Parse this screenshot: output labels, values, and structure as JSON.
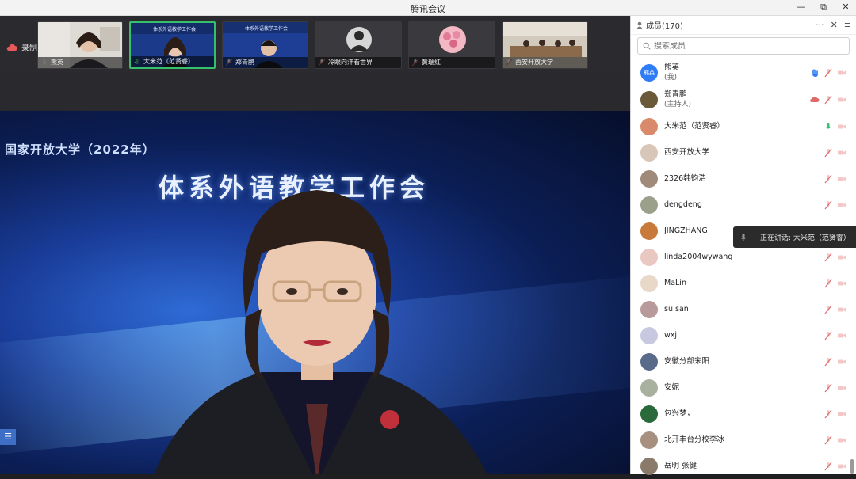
{
  "window": {
    "title": "腾讯会议",
    "min": "—",
    "restore": "⧉",
    "close": "✕"
  },
  "recording": {
    "label": "录制中"
  },
  "thumbnails": [
    {
      "name": "熊英",
      "active": false,
      "bg": "#d9d4cf"
    },
    {
      "name": "大米范（范贤睿）",
      "active": true,
      "bg": "#1b3a8a"
    },
    {
      "name": "郑青鹏",
      "active": false,
      "bg": "#1d3e94"
    },
    {
      "name": "冷眼向洋看世界",
      "active": false,
      "bg": "#3a3a3e"
    },
    {
      "name": "黄瑞红",
      "active": false,
      "bg": "#3a3a3e"
    },
    {
      "name": "西安开放大学",
      "active": false,
      "bg": "#cfc8bd"
    }
  ],
  "main_video": {
    "heading_small": "国家开放大学（2022年）",
    "heading_large": "体系外语教学工作会"
  },
  "side_button": "☰",
  "panel": {
    "title": "成员(170)",
    "more": "···",
    "close": "✕",
    "menu": "≡",
    "search_placeholder": "搜索成员"
  },
  "members": [
    {
      "name": "熊英",
      "sub": "(我)",
      "avatar_text": "熊英",
      "avatar_color": "#2f7df6",
      "mic": "hand"
    },
    {
      "name": "郑青鹏",
      "sub": "(主持人)",
      "avatar_text": "",
      "avatar_color": "#6b5a3a",
      "mic": "muted"
    },
    {
      "name": "大米范（范贤睿）",
      "sub": "",
      "avatar_text": "",
      "avatar_color": "#d98a6a",
      "mic": "on"
    },
    {
      "name": "西安开放大学",
      "sub": "",
      "avatar_text": "",
      "avatar_color": "#d8c6b8",
      "mic": "muted"
    },
    {
      "name": "2326韩钧浩",
      "sub": "",
      "avatar_text": "",
      "avatar_color": "#a08a7a",
      "mic": "muted"
    },
    {
      "name": "dengdeng",
      "sub": "",
      "avatar_text": "",
      "avatar_color": "#9aa08a",
      "mic": "muted"
    },
    {
      "name": "JINGZHANG",
      "sub": "",
      "avatar_text": "",
      "avatar_color": "#c87a3a",
      "mic": "muted"
    },
    {
      "name": "linda2004wywang",
      "sub": "",
      "avatar_text": "",
      "avatar_color": "#e8c8c0",
      "mic": "muted"
    },
    {
      "name": "MaLin",
      "sub": "",
      "avatar_text": "",
      "avatar_color": "#e8d8c8",
      "mic": "muted"
    },
    {
      "name": "su san",
      "sub": "",
      "avatar_text": "",
      "avatar_color": "#b89a9a",
      "mic": "muted"
    },
    {
      "name": "wxj",
      "sub": "",
      "avatar_text": "",
      "avatar_color": "#c8c8e0",
      "mic": "muted"
    },
    {
      "name": "安徽分部宋阳",
      "sub": "",
      "avatar_text": "",
      "avatar_color": "#5a6a8a",
      "mic": "muted"
    },
    {
      "name": "安妮",
      "sub": "",
      "avatar_text": "",
      "avatar_color": "#a8b0a0",
      "mic": "muted"
    },
    {
      "name": "包兴梦，",
      "sub": "",
      "avatar_text": "",
      "avatar_color": "#2a6a3a",
      "mic": "muted"
    },
    {
      "name": "北开丰台分校李冰",
      "sub": "",
      "avatar_text": "",
      "avatar_color": "#a89080",
      "mic": "muted"
    },
    {
      "name": "岳明 张健",
      "sub": "",
      "avatar_text": "",
      "avatar_color": "#8a7a6a",
      "mic": "muted"
    }
  ],
  "tooltip": {
    "text": "正在讲话: 大米范（范贤睿）"
  },
  "colors": {
    "mic_on": "#35c06b",
    "mic_muted": "#e06a6a",
    "hand": "#2f7df6",
    "accent": "#3f6ec7"
  }
}
